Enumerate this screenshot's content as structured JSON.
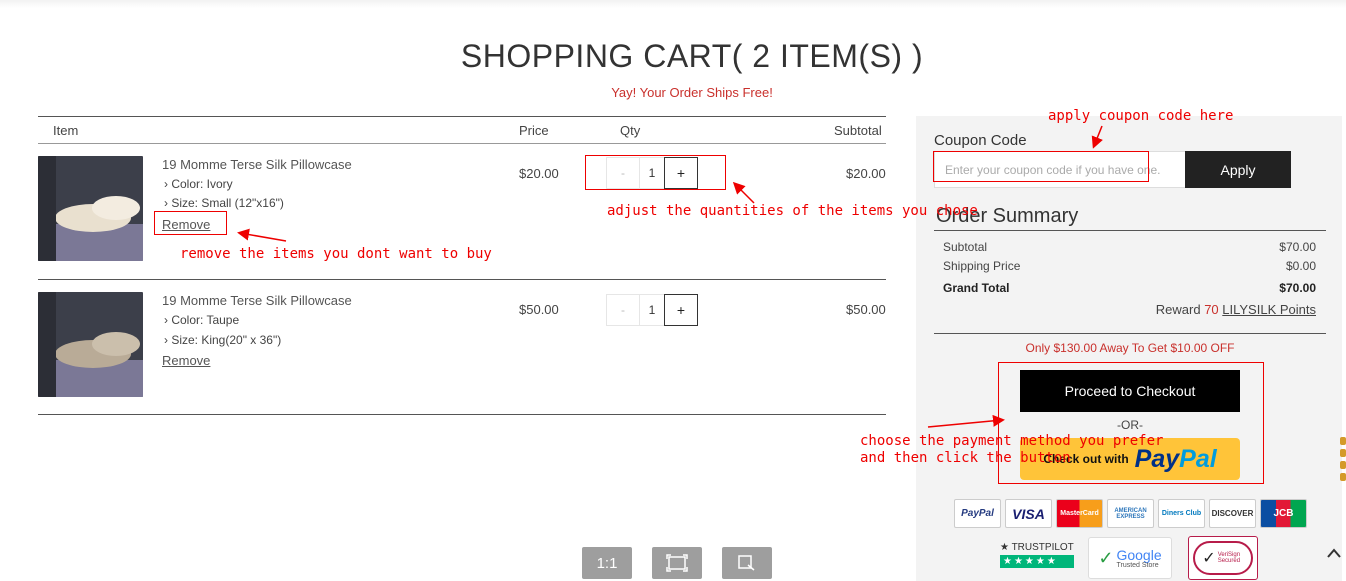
{
  "header": {
    "title": "SHOPPING CART( 2 ITEM(S) )",
    "free_shipping": "Yay! Your Order Ships Free!"
  },
  "table": {
    "columns": [
      "Item",
      "Price",
      "Qty",
      "Subtotal"
    ]
  },
  "items": [
    {
      "name": "19 Momme Terse Silk Pillowcase",
      "color": "› Color:  Ivory",
      "size": "› Size:  Small (12\"x16\")",
      "remove": "Remove",
      "price": "$20.00",
      "qty_minus": "-",
      "qty": "1",
      "qty_plus": "+",
      "subtotal": "$20.00",
      "swatch": "#e9e0cf"
    },
    {
      "name": "19 Momme Terse Silk Pillowcase",
      "color": "› Color:  Taupe",
      "size": "› Size:  King(20\" x 36\")",
      "remove": "Remove",
      "price": "$50.00",
      "qty_minus": "-",
      "qty": "1",
      "qty_plus": "+",
      "subtotal": "$50.00",
      "swatch": "#b9ab97"
    }
  ],
  "coupon": {
    "label": "Coupon Code",
    "placeholder": "Enter your coupon code if you have one.",
    "apply": "Apply"
  },
  "summary": {
    "title": "Order Summary",
    "subtotal_label": "Subtotal",
    "subtotal": "$70.00",
    "shipping_label": "Shipping Price",
    "shipping": "$0.00",
    "grand_label": "Grand Total",
    "grand": "$70.00",
    "reward_prefix": "Reward",
    "reward_points": "70",
    "reward_link": "LILYSILK Points",
    "offer": "Only $130.00 Away To Get $10.00 OFF",
    "checkout": "Proceed to Checkout",
    "or": "-OR-",
    "paypal_text": "Check out with",
    "paypal_logo_a": "Pay",
    "paypal_logo_b": "Pal"
  },
  "payment_cards": [
    "PayPal",
    "VISA",
    "MasterCard",
    "AMERICAN EXPRESS",
    "Diners Club",
    "DISCOVER",
    "JCB"
  ],
  "trust": {
    "trustpilot": "TRUSTPILOT",
    "google": "Google",
    "google_sub": "Trusted Store",
    "verisign": "VeriSign Secured"
  },
  "annotations": {
    "coupon": "apply coupon code here",
    "qty": "adjust the quantities of the items you chose",
    "remove": "remove the items you dont want to buy",
    "pay_line1": "choose the payment method you prefer",
    "pay_line2": "and then click the button"
  },
  "viewer_toolbar": {
    "actual_size": "1:1"
  },
  "colors": {
    "accent_red": "#c9302c",
    "annotation_red": "#e00000",
    "paypal_yellow": "#ffc439"
  }
}
